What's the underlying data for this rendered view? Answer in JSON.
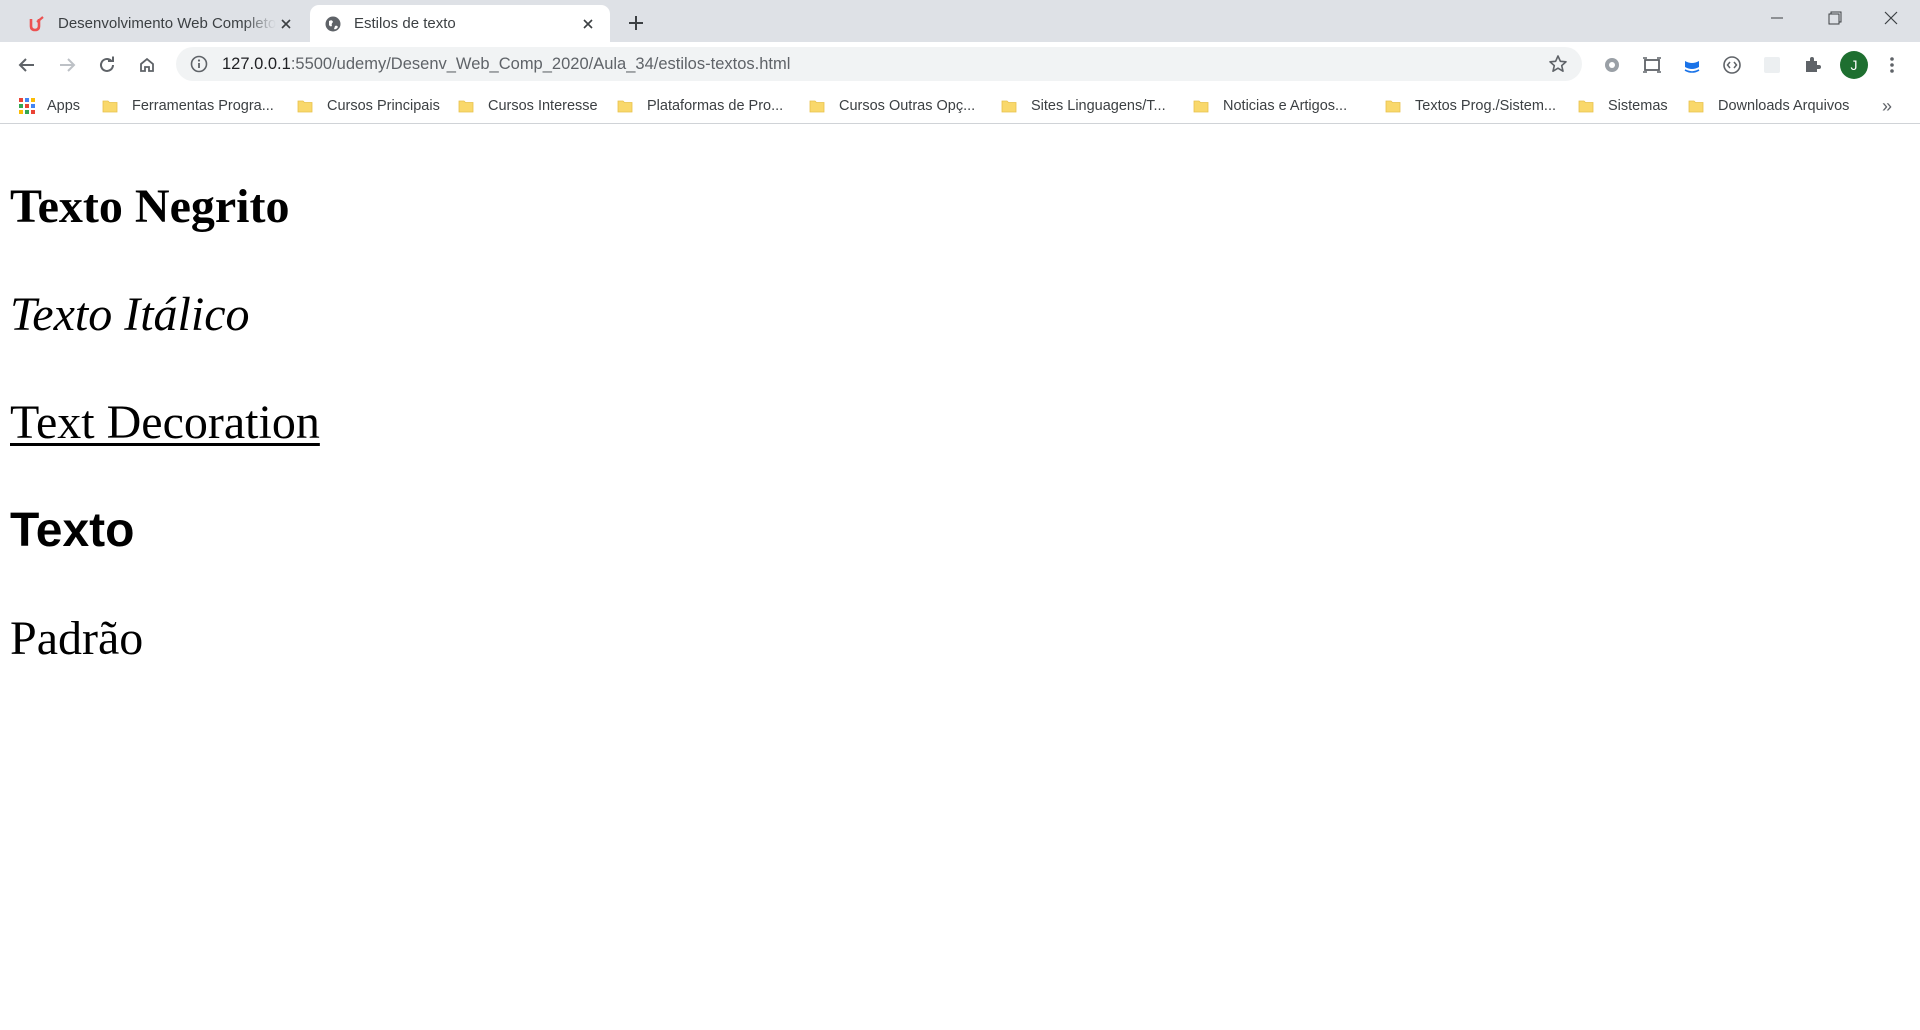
{
  "browser": {
    "tabs": [
      {
        "title": "Desenvolvimento Web Completo",
        "favicon": "udemy-icon",
        "active": false
      },
      {
        "title": "Estilos de texto",
        "favicon": "globe-icon",
        "active": true
      }
    ],
    "address_bar": {
      "host": "127.0.0.1",
      "rest": ":5500/udemy/Desenv_Web_Comp_2020/Aula_34/estilos-textos.html"
    },
    "profile_initial": "J",
    "bookmarks": [
      {
        "label": "Apps",
        "icon": "apps-grid-icon"
      },
      {
        "label": "Ferramentas Progra...",
        "icon": "folder-icon"
      },
      {
        "label": "Cursos Principais",
        "icon": "folder-icon"
      },
      {
        "label": "Cursos Interesse",
        "icon": "folder-icon"
      },
      {
        "label": "Plataformas de Pro...",
        "icon": "folder-icon"
      },
      {
        "label": "Cursos Outras Opç...",
        "icon": "folder-icon"
      },
      {
        "label": "Sites Linguagens/T...",
        "icon": "folder-icon"
      },
      {
        "label": "Noticias e Artigos...",
        "icon": "folder-icon"
      },
      {
        "label": "Textos Prog./Sistem...",
        "icon": "folder-icon"
      },
      {
        "label": "Sistemas",
        "icon": "folder-icon"
      },
      {
        "label": "Downloads Arquivos",
        "icon": "folder-icon"
      }
    ],
    "bookmarks_overflow": "»",
    "colors": {
      "tabstrip": "#dee1e6",
      "omnibox": "#f1f3f4",
      "avatar": "#1e6f30",
      "folder": "#f9d86b"
    }
  },
  "content": {
    "bold_text": "Texto Negrito",
    "italic_text": "Texto Itálico",
    "decoration_text": "Text Decoration",
    "sans_text": "Texto",
    "plain_text": "Padrão"
  }
}
